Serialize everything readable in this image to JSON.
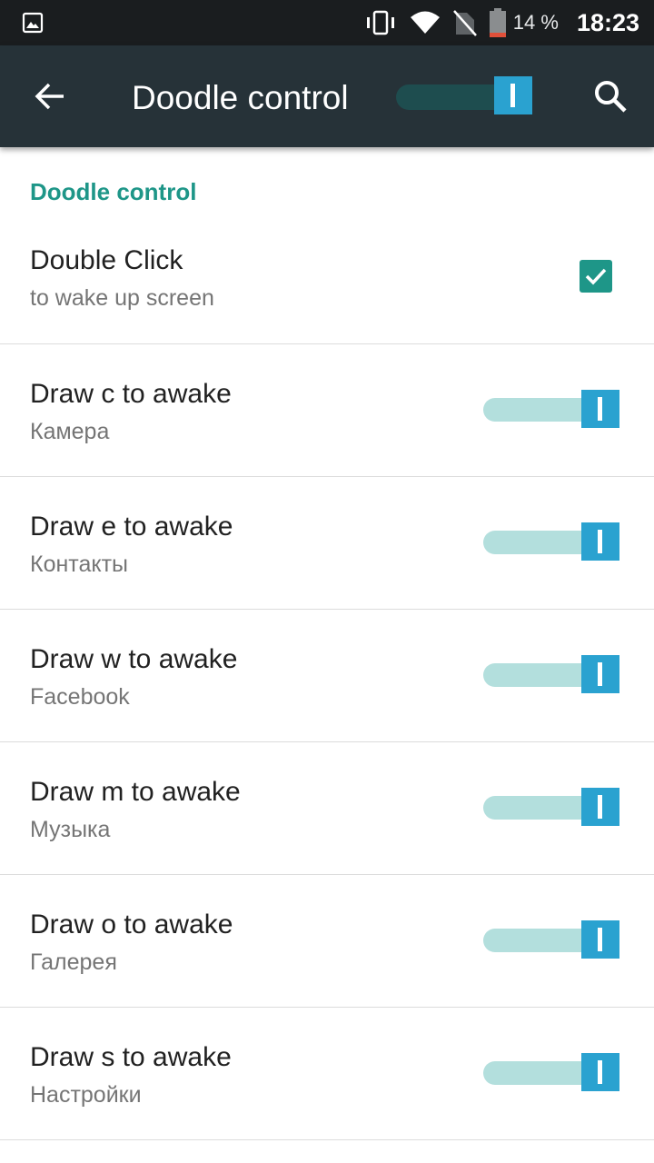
{
  "status_bar": {
    "battery_percent": "14 %",
    "time": "18:23"
  },
  "toolbar": {
    "title": "Doodle control",
    "master_switch_on": true
  },
  "section": {
    "title": "Doodle control"
  },
  "double_click": {
    "title": "Double Click",
    "subtitle": "to wake up screen",
    "checked": true
  },
  "gestures": [
    {
      "title": "Draw c to awake",
      "app": "Камера",
      "enabled": true
    },
    {
      "title": "Draw e to awake",
      "app": "Контакты",
      "enabled": true
    },
    {
      "title": "Draw w to awake",
      "app": "Facebook",
      "enabled": true
    },
    {
      "title": "Draw m to awake",
      "app": "Музыка",
      "enabled": true
    },
    {
      "title": "Draw o to awake",
      "app": "Галерея",
      "enabled": true
    },
    {
      "title": "Draw s to awake",
      "app": "Настройки",
      "enabled": true
    }
  ],
  "colors": {
    "accent": "#1e9688",
    "toolbar": "#263238",
    "switch_thumb": "#2aa2d0",
    "switch_track": "#b3dfdd"
  }
}
